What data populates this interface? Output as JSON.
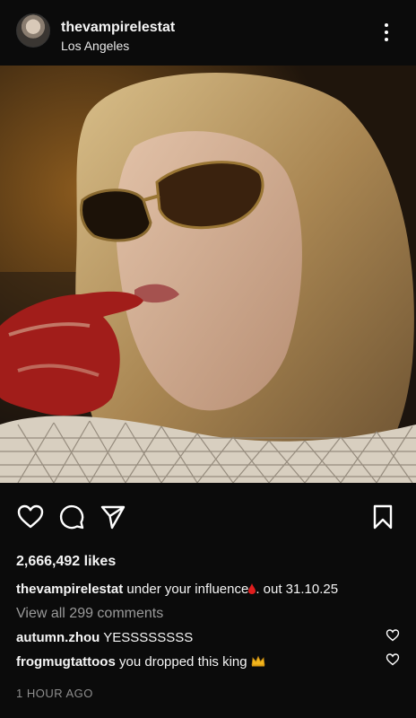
{
  "post": {
    "username": "thevampirelestat",
    "location": "Los Angeles",
    "likes": "2,666,492 likes",
    "caption_user": "thevampirelestat",
    "caption_text": "under your influence",
    "caption_text_2": ". out 31.10.25",
    "view_all": "View all 299 comments",
    "time": "1 HOUR AGO"
  },
  "comments": [
    {
      "user": "autumn.zhou",
      "text": "YESSSSSSSS"
    },
    {
      "user": "frogmugtattoos",
      "text": "you dropped this king"
    }
  ],
  "icons": [
    "more-icon",
    "heart-icon",
    "comment-icon",
    "share-icon",
    "bookmark-icon",
    "blood-drop-emoji",
    "crown-emoji"
  ],
  "colors": {
    "background": "#0b0b0b",
    "text": "#f5f5f5",
    "muted": "#9a9a9a"
  }
}
